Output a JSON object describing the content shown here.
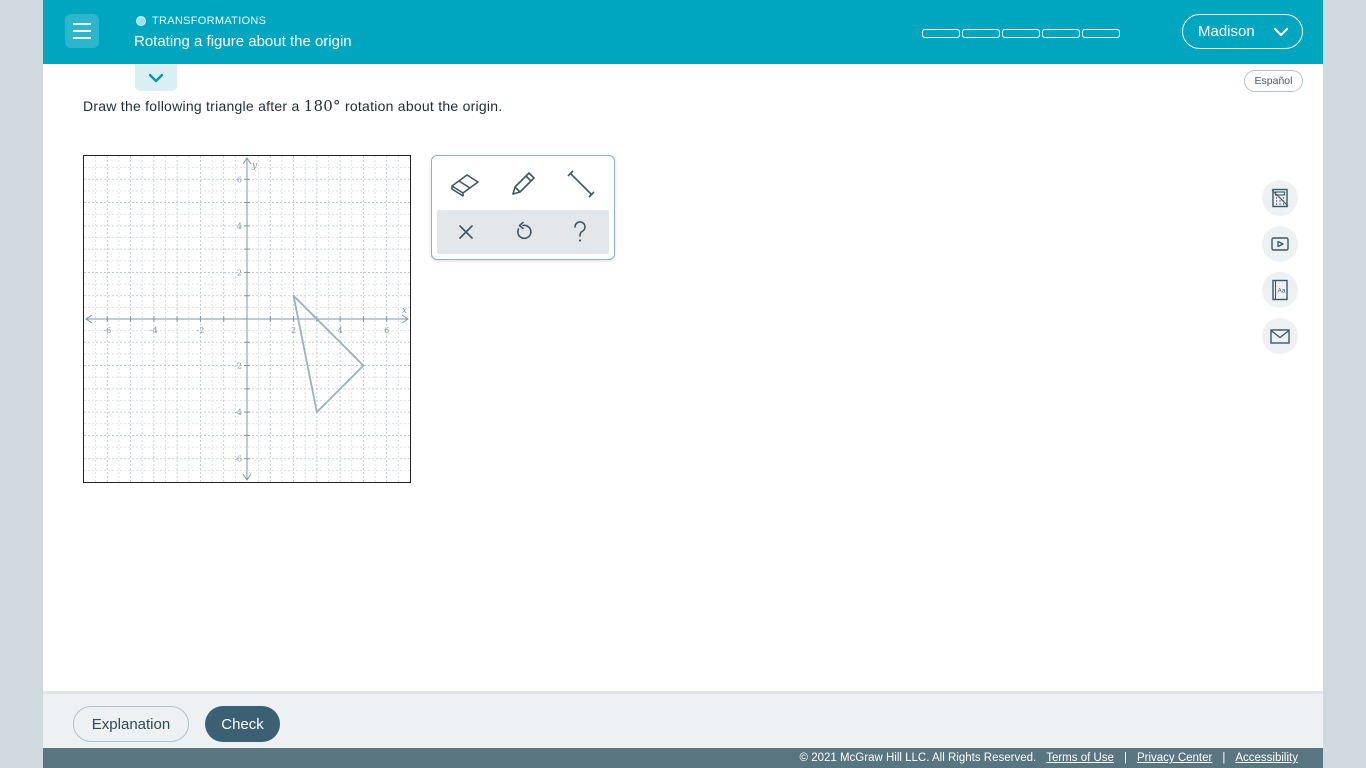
{
  "header": {
    "topic": "TRANSFORMATIONS",
    "title": "Rotating a figure about the origin",
    "progress_segments": 5,
    "user_name": "Madison"
  },
  "language_button": "Español",
  "question": {
    "text_before": "Draw the following triangle after a ",
    "math": "180°",
    "text_after": " rotation about the origin."
  },
  "graph": {
    "xlabel": "x",
    "ylabel": "y",
    "x_ticks": [
      "-6",
      "-4",
      "-2",
      "2",
      "4",
      "6"
    ],
    "y_ticks": [
      "6",
      "4",
      "2",
      "-2",
      "-4",
      "-6"
    ],
    "range": [
      -7,
      7
    ],
    "triangle": [
      [
        2,
        1
      ],
      [
        5,
        -2
      ],
      [
        3,
        -4
      ]
    ]
  },
  "toolbox": {
    "tools": [
      "eraser-icon",
      "pencil-icon",
      "line-segment-icon"
    ],
    "actions": [
      "clear-icon",
      "undo-icon",
      "help-icon"
    ]
  },
  "side_tools": [
    "calculator-icon",
    "video-icon",
    "glossary-icon",
    "message-icon"
  ],
  "footer": {
    "explanation": "Explanation",
    "check": "Check"
  },
  "legal": {
    "copyright": "© 2021 McGraw Hill LLC. All Rights Reserved.",
    "terms": "Terms of Use",
    "privacy": "Privacy Center",
    "accessibility": "Accessibility",
    "separator": "|"
  }
}
